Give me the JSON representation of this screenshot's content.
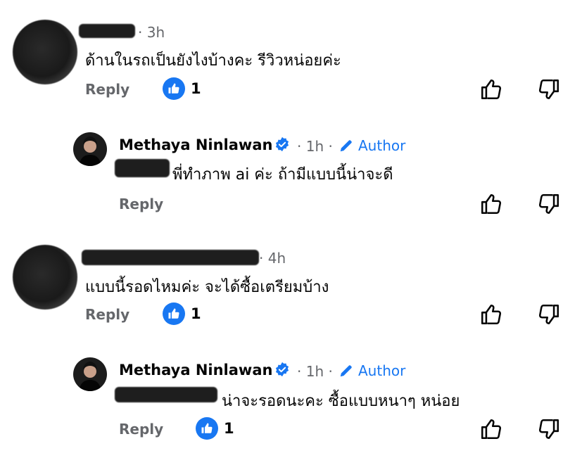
{
  "comments": [
    {
      "type": "comment",
      "author": "",
      "time": "3h",
      "text": "ด้านในรถเป็นยังไงบ้างคะ รีวิวหน่อยค่ะ",
      "reply_label": "Reply",
      "like_count": "1"
    },
    {
      "type": "reply",
      "author": "Methaya Ninlawan",
      "time": "1h",
      "badge": "Author",
      "text": "พี่ทำภาพ ai ค่ะ ถ้ามีแบบนี้น่าจะดี",
      "reply_label": "Reply",
      "like_count": ""
    },
    {
      "type": "comment",
      "author": "",
      "time": "4h",
      "text": "แบบนี้รอดไหมค่ะ จะได้ซื้อเตรียมบ้าง",
      "reply_label": "Reply",
      "like_count": "1"
    },
    {
      "type": "reply",
      "author": "Methaya Ninlawan",
      "time": "1h",
      "badge": "Author",
      "text": "น่าจะรอดนะคะ ซื้อแบบหนาๆ หน่อย",
      "reply_label": "Reply",
      "like_count": "1"
    }
  ],
  "colors": {
    "accent": "#1877f2",
    "secondary_text": "#65676b",
    "primary_text": "#050505"
  },
  "icons": {
    "like": "like-thumb-icon",
    "upvote": "thumbs-up-icon",
    "downvote": "thumbs-down-icon",
    "verified": "verified-badge-icon",
    "author": "pencil-icon"
  }
}
